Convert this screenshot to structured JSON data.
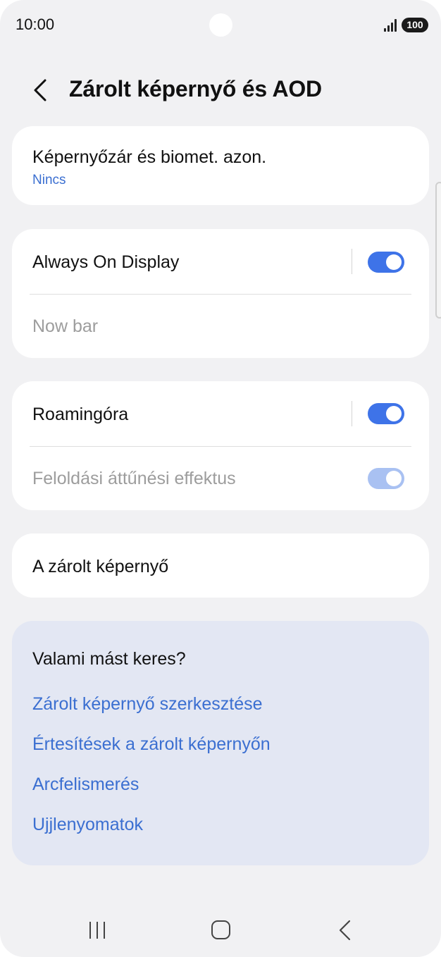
{
  "status_bar": {
    "time": "10:00",
    "battery": "100"
  },
  "header": {
    "title": "Zárolt képernyő és AOD"
  },
  "screen_lock": {
    "label": "Képernyőzár és biomet. azon.",
    "value": "Nincs"
  },
  "aod_card": {
    "always_on_display": {
      "label": "Always On Display",
      "enabled": true
    },
    "now_bar": {
      "label": "Now bar"
    }
  },
  "roaming_card": {
    "roaming_clock": {
      "label": "Roamingóra",
      "enabled": true
    },
    "unlock_transition": {
      "label": "Feloldási áttűnési effektus",
      "enabled": true
    }
  },
  "lock_screen": {
    "label": "A zárolt képernyő"
  },
  "suggestions": {
    "title": "Valami mást keres?",
    "links": [
      "Zárolt képernyő szerkesztése",
      "Értesítések a zárolt képernyőn",
      "Arcfelismerés",
      "Ujjlenyomatok"
    ]
  },
  "colors": {
    "accent": "#3e73e8",
    "link": "#3b6fd1",
    "suggestion_bg": "#e3e7f3",
    "background": "#f1f1f3"
  }
}
